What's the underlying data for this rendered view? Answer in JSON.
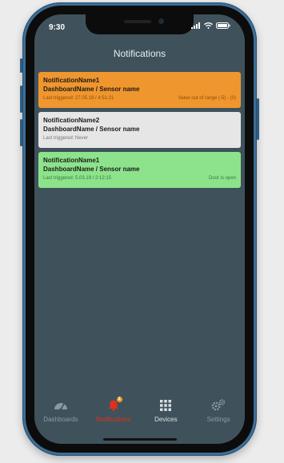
{
  "status_bar": {
    "time": "9:30"
  },
  "header": {
    "title": "Notifications"
  },
  "notifications": [
    {
      "name": "NotificationName1",
      "subtitle": "DashboardName / Sensor name",
      "last_triggered": "Last triggered: 27.05.19 / 4:51:21",
      "detail": "Value out of range (-5) - (0)",
      "color": "#f0962e"
    },
    {
      "name": "NotificationName2",
      "subtitle": "DashboardName / Sensor name",
      "last_triggered": "Last triggered: Never",
      "detail": "",
      "color": "#e6e6e6"
    },
    {
      "name": "NotificationName1",
      "subtitle": "DashboardName / Sensor name",
      "last_triggered": "Last triggered: 5.03.19 / 2:12:15",
      "detail": "Door is open",
      "color": "#8de38b"
    }
  ],
  "tabbar": {
    "items": [
      {
        "label": "Dashboards",
        "icon": "gauge-icon"
      },
      {
        "label": "Notifications",
        "icon": "bell-icon",
        "badge": "1",
        "active": true
      },
      {
        "label": "Devices",
        "icon": "grid-icon"
      },
      {
        "label": "Settings",
        "icon": "gears-icon"
      }
    ]
  },
  "colors": {
    "accent": "#e0301c",
    "screen_bg": "#3f525b",
    "frame": "#3c6e96"
  }
}
